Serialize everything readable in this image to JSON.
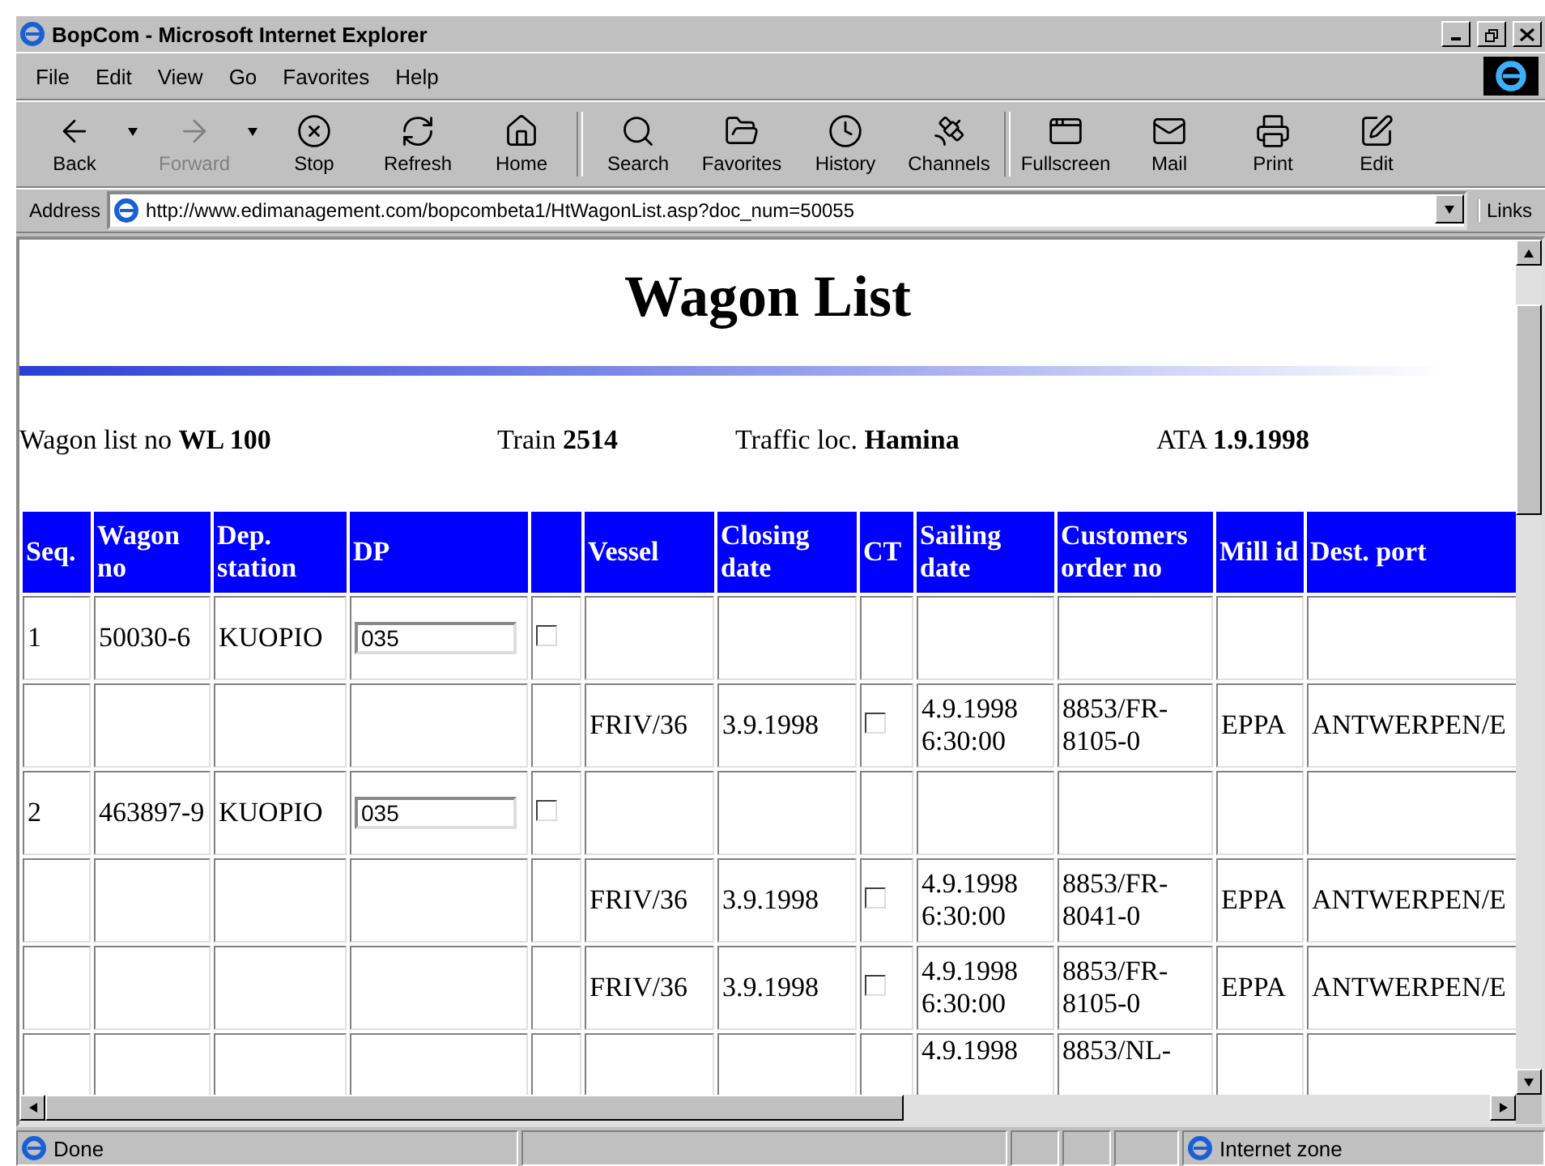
{
  "window": {
    "title": "BopCom - Microsoft Internet Explorer"
  },
  "menu": [
    "File",
    "Edit",
    "View",
    "Go",
    "Favorites",
    "Help"
  ],
  "toolbar": [
    {
      "label": "Back",
      "disabled": false
    },
    {
      "label": "Forward",
      "disabled": true
    },
    {
      "label": "Stop",
      "disabled": false
    },
    {
      "label": "Refresh",
      "disabled": false
    },
    {
      "label": "Home",
      "disabled": false
    },
    {
      "label": "Search",
      "disabled": false
    },
    {
      "label": "Favorites",
      "disabled": false
    },
    {
      "label": "History",
      "disabled": false
    },
    {
      "label": "Channels",
      "disabled": false
    },
    {
      "label": "Fullscreen",
      "disabled": false
    },
    {
      "label": "Mail",
      "disabled": false
    },
    {
      "label": "Print",
      "disabled": false
    },
    {
      "label": "Edit",
      "disabled": false
    }
  ],
  "address": {
    "label": "Address",
    "url": "http://www.edimanagement.com/bopcombeta1/HtWagonList.asp?doc_num=50055",
    "links": "Links"
  },
  "page": {
    "heading": "Wagon List",
    "info": [
      {
        "label": "Wagon list no",
        "value": "WL 100"
      },
      {
        "label": "Train",
        "value": "2514"
      },
      {
        "label": "Traffic loc.",
        "value": "Hamina"
      },
      {
        "label": "ATA",
        "value": "1.9.1998"
      }
    ]
  },
  "table": {
    "columns": [
      "Seq.",
      "Wagon no",
      "Dep. station",
      "DP",
      "",
      "Vessel",
      "Closing date",
      "CT",
      "Sailing date",
      "Customers order no",
      "Mill id",
      "Dest. port"
    ],
    "rows": [
      {
        "kind": "wagon",
        "seq": "1",
        "wagon_no": "50030-6",
        "station": "KUOPIO",
        "dp": "035",
        "checked": false
      },
      {
        "kind": "order",
        "vessel": "FRIV/36",
        "closing": "3.9.1998",
        "checked": false,
        "sailing": "4.9.1998 6:30:00",
        "order_no": "8853/FR-8105-0",
        "mill": "EPPA",
        "dest": "ANTWERPEN/E"
      },
      {
        "kind": "wagon",
        "seq": "2",
        "wagon_no": "463897-9",
        "station": "KUOPIO",
        "dp": "035",
        "checked": false
      },
      {
        "kind": "order",
        "vessel": "FRIV/36",
        "closing": "3.9.1998",
        "checked": false,
        "sailing": "4.9.1998 6:30:00",
        "order_no": "8853/FR-8041-0",
        "mill": "EPPA",
        "dest": "ANTWERPEN/E"
      },
      {
        "kind": "order",
        "vessel": "FRIV/36",
        "closing": "3.9.1998",
        "checked": false,
        "sailing": "4.9.1998 6:30:00",
        "order_no": "8853/FR-8105-0",
        "mill": "EPPA",
        "dest": "ANTWERPEN/E"
      },
      {
        "kind": "cut",
        "sailing": "4.9.1998",
        "order_no": "8853/NL-"
      }
    ]
  },
  "status_bar": {
    "text": "Done",
    "zone": "Internet zone"
  }
}
